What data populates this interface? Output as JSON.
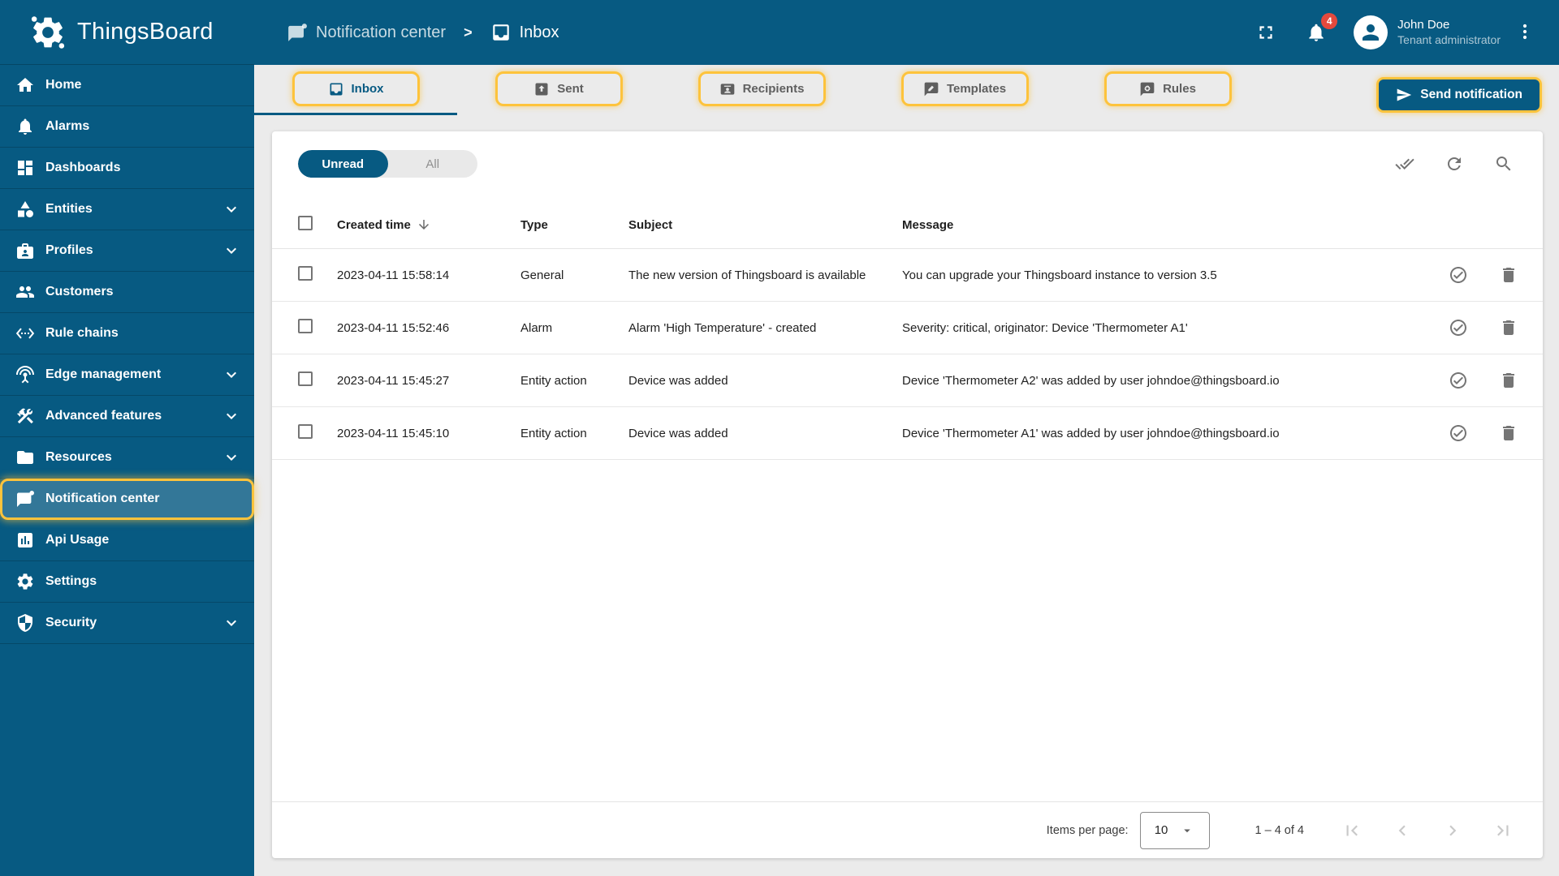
{
  "app": {
    "logo_text": "ThingsBoard"
  },
  "colors": {
    "primary": "#075a82",
    "accent": "#fdc33c",
    "badge_red": "#e5493d",
    "page_bg": "#ebebeb"
  },
  "breadcrumb": {
    "separator": ">",
    "items": [
      {
        "label": "Notification center",
        "icon": "notification-center"
      },
      {
        "label": "Inbox",
        "icon": "inbox"
      }
    ]
  },
  "header": {
    "notifications_badge": "4",
    "user": {
      "name": "John Doe",
      "role": "Tenant administrator"
    }
  },
  "sidebar": {
    "items": [
      {
        "label": "Home",
        "icon": "home"
      },
      {
        "label": "Alarms",
        "icon": "alarms"
      },
      {
        "label": "Dashboards",
        "icon": "dashboards"
      },
      {
        "label": "Entities",
        "icon": "entities",
        "expandable": true
      },
      {
        "label": "Profiles",
        "icon": "profiles",
        "expandable": true
      },
      {
        "label": "Customers",
        "icon": "customers"
      },
      {
        "label": "Rule chains",
        "icon": "rule-chains"
      },
      {
        "label": "Edge management",
        "icon": "edge-management",
        "expandable": true
      },
      {
        "label": "Advanced features",
        "icon": "advanced-features",
        "expandable": true
      },
      {
        "label": "Resources",
        "icon": "resources",
        "expandable": true
      },
      {
        "label": "Notification center",
        "icon": "notification-center",
        "selected": true
      },
      {
        "label": "Api Usage",
        "icon": "api-usage"
      },
      {
        "label": "Settings",
        "icon": "settings"
      },
      {
        "label": "Security",
        "icon": "security",
        "expandable": true
      }
    ]
  },
  "tabs": [
    {
      "label": "Inbox",
      "icon": "inbox",
      "active": true
    },
    {
      "label": "Sent",
      "icon": "sent"
    },
    {
      "label": "Recipients",
      "icon": "recipients"
    },
    {
      "label": "Templates",
      "icon": "templates"
    },
    {
      "label": "Rules",
      "icon": "rules"
    }
  ],
  "actions": {
    "send_notification": "Send notification"
  },
  "toolbar": {
    "filter": {
      "unread": "Unread",
      "all": "All",
      "selected": "Unread"
    }
  },
  "table": {
    "columns": [
      "Created time",
      "Type",
      "Subject",
      "Message"
    ],
    "rows": [
      {
        "created_time": "2023-04-11 15:58:14",
        "type": "General",
        "subject": "The new version of Thingsboard is available",
        "message": "You can upgrade your Thingsboard instance to version 3.5"
      },
      {
        "created_time": "2023-04-11 15:52:46",
        "type": "Alarm",
        "subject": "Alarm 'High Temperature' - created",
        "message": "Severity: critical, originator: Device 'Thermometer A1'"
      },
      {
        "created_time": "2023-04-11 15:45:27",
        "type": "Entity action",
        "subject": "Device was added",
        "message": "Device 'Thermometer A2' was added by user johndoe@thingsboard.io"
      },
      {
        "created_time": "2023-04-11 15:45:10",
        "type": "Entity action",
        "subject": "Device was added",
        "message": "Device 'Thermometer A1' was added by user johndoe@thingsboard.io"
      }
    ]
  },
  "pagination": {
    "items_per_page_label": "Items per page:",
    "page_size": "10",
    "range": "1 – 4 of 4"
  }
}
